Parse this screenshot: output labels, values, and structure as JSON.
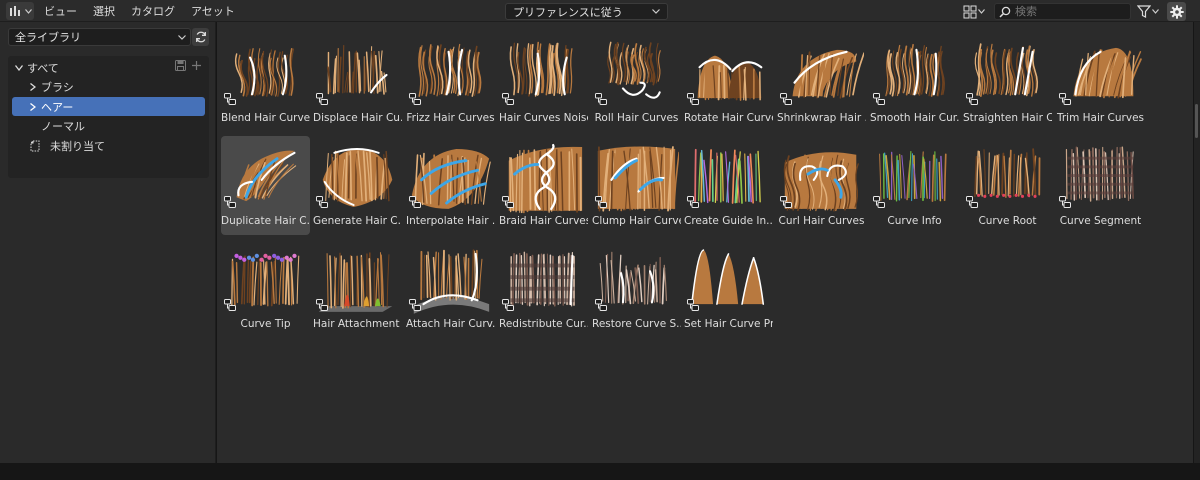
{
  "header": {
    "menu": [
      "ビュー",
      "選択",
      "カタログ",
      "アセット"
    ],
    "import_mode": "プリファレンスに従う",
    "search_placeholder": "検索"
  },
  "sidebar": {
    "library": "全ライブラリ",
    "tree": [
      {
        "label": "すべて",
        "level": 0,
        "chevron": "down"
      },
      {
        "label": "ブラシ",
        "level": 1,
        "chevron": "right"
      },
      {
        "label": "ヘアー",
        "level": 1,
        "chevron": "right",
        "selected": true
      },
      {
        "label": "ノーマル",
        "level": 1,
        "chevron": "none"
      },
      {
        "label": "未割り当て",
        "level": 0,
        "chevron": "none",
        "icon": "unassigned-icon"
      }
    ]
  },
  "assets": [
    {
      "label": "Blend Hair Curves",
      "style": "blend"
    },
    {
      "label": "Displace Hair Cu...",
      "style": "displace"
    },
    {
      "label": "Frizz Hair Curves",
      "style": "frizz"
    },
    {
      "label": "Hair Curves Noise",
      "style": "noise"
    },
    {
      "label": "Roll Hair Curves",
      "style": "roll"
    },
    {
      "label": "Rotate Hair Curves",
      "style": "rotate"
    },
    {
      "label": "Shrinkwrap Hair ...",
      "style": "shrink"
    },
    {
      "label": "Smooth Hair Cur...",
      "style": "smooth"
    },
    {
      "label": "Straighten Hair C...",
      "style": "straight"
    },
    {
      "label": "Trim Hair Curves",
      "style": "trim"
    },
    {
      "label": "Duplicate Hair C...",
      "style": "duplicate",
      "active": true
    },
    {
      "label": "Generate Hair C...",
      "style": "generate"
    },
    {
      "label": "Interpolate Hair ...",
      "style": "interp"
    },
    {
      "label": "Braid Hair Curves",
      "style": "braid"
    },
    {
      "label": "Clump Hair Curves",
      "style": "clump"
    },
    {
      "label": "Create Guide In...",
      "style": "guide"
    },
    {
      "label": "Curl Hair Curves",
      "style": "curl"
    },
    {
      "label": "Curve Info",
      "style": "info"
    },
    {
      "label": "Curve Root",
      "style": "root"
    },
    {
      "label": "Curve Segment",
      "style": "segment"
    },
    {
      "label": "Curve Tip",
      "style": "tip"
    },
    {
      "label": "Hair Attachment ...",
      "style": "attach1"
    },
    {
      "label": "Attach Hair Curv...",
      "style": "attach2"
    },
    {
      "label": "Redistribute Cur...",
      "style": "redis"
    },
    {
      "label": "Restore Curve S...",
      "style": "restore"
    },
    {
      "label": "Set Hair Curve Pr...",
      "style": "setprof"
    }
  ],
  "colors": {
    "hair": "#b8793f",
    "hair_dark": "#6e4220",
    "hair_light": "#e2b07a",
    "highlight": "#ffffff",
    "guide": "#3da6e8",
    "selection": "#4671b8"
  }
}
